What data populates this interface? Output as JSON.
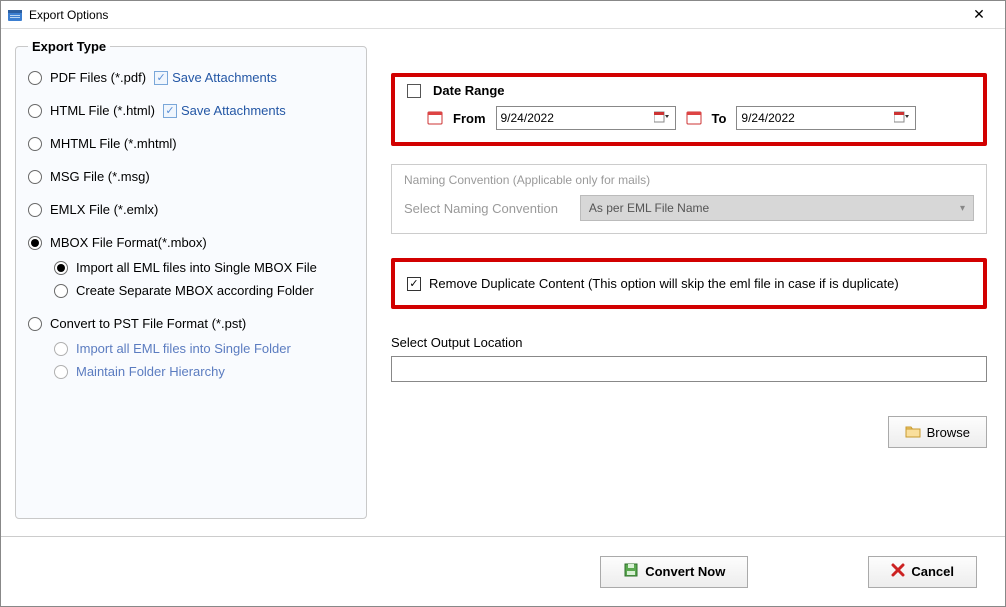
{
  "window": {
    "title": "Export Options"
  },
  "export_type": {
    "legend": "Export Type",
    "attachments_label": "Save Attachments",
    "options": {
      "pdf": "PDF Files (*.pdf)",
      "html": "HTML File  (*.html)",
      "mhtml": "MHTML File  (*.mhtml)",
      "msg": "MSG File (*.msg)",
      "emlx": "EMLX File (*.emlx)",
      "mbox": "MBOX File Format(*.mbox)",
      "pst": "Convert to PST File Format (*.pst)"
    },
    "mbox_sub": {
      "single": "Import all EML files into Single MBOX File",
      "separate": "Create Separate MBOX according Folder"
    },
    "pst_sub": {
      "single": "Import all EML files into Single Folder",
      "hierarchy": "Maintain Folder Hierarchy"
    }
  },
  "date_range": {
    "title": "Date Range",
    "from_label": "From",
    "from_value": "9/24/2022",
    "to_label": "To",
    "to_value": "9/24/2022"
  },
  "naming": {
    "title": "Naming Convention (Applicable only for mails)",
    "label": "Select Naming Convention",
    "value": "As per EML File Name"
  },
  "duplicate": {
    "label": "Remove Duplicate Content (This option will skip the eml file in case if is duplicate)"
  },
  "output": {
    "label": "Select Output Location",
    "value": ""
  },
  "buttons": {
    "browse": "Browse",
    "convert": "Convert Now",
    "cancel": "Cancel"
  }
}
